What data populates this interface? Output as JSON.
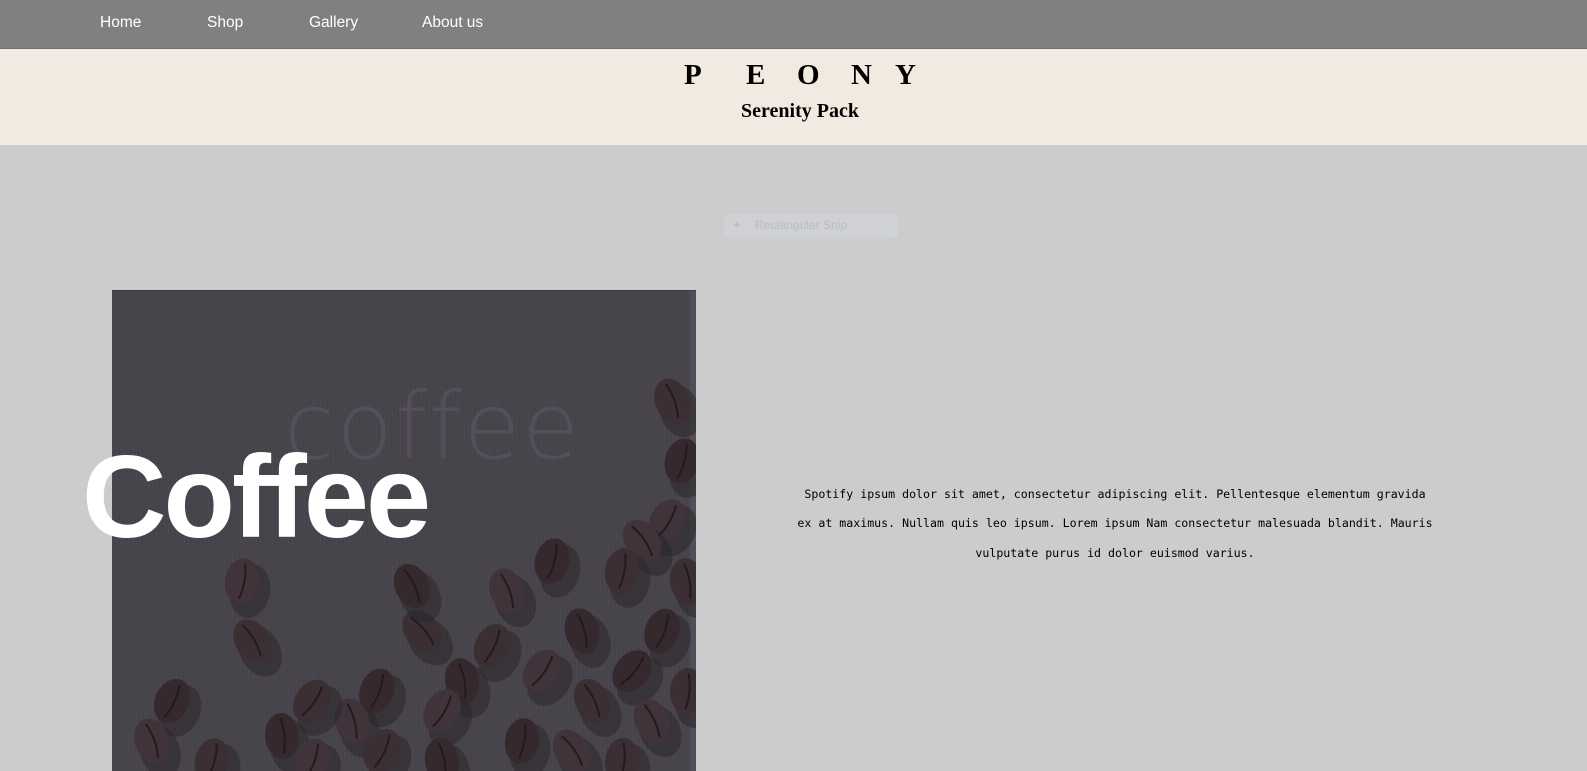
{
  "nav": {
    "items": [
      {
        "label": "Home"
      },
      {
        "label": "Shop"
      },
      {
        "label": "Gallery"
      },
      {
        "label": "About us"
      }
    ]
  },
  "header": {
    "brand_letters": [
      "P",
      "E",
      "O",
      "N",
      "Y"
    ],
    "subtitle": "Serenity Pack"
  },
  "overlay": {
    "snip_label": "Rectangular Snip",
    "snip_icon": "snip-icon"
  },
  "hero": {
    "title": "Coffee",
    "image_watermark": "coffee",
    "image_subject": "coffee beans on dark cloth"
  },
  "content": {
    "description": "Spotify ipsum dolor sit amet, consectetur adipiscing elit. Pellentesque elementum gravida ex at maximus. Nullam quis leo ipsum. Lorem ipsum Nam consectetur malesuada blandit. Mauris vulputate purus id dolor euismod varius."
  },
  "colors": {
    "navbar": "#808080",
    "header": "#f2e9e0",
    "page": "#cccccc",
    "photo": "#47434a"
  }
}
